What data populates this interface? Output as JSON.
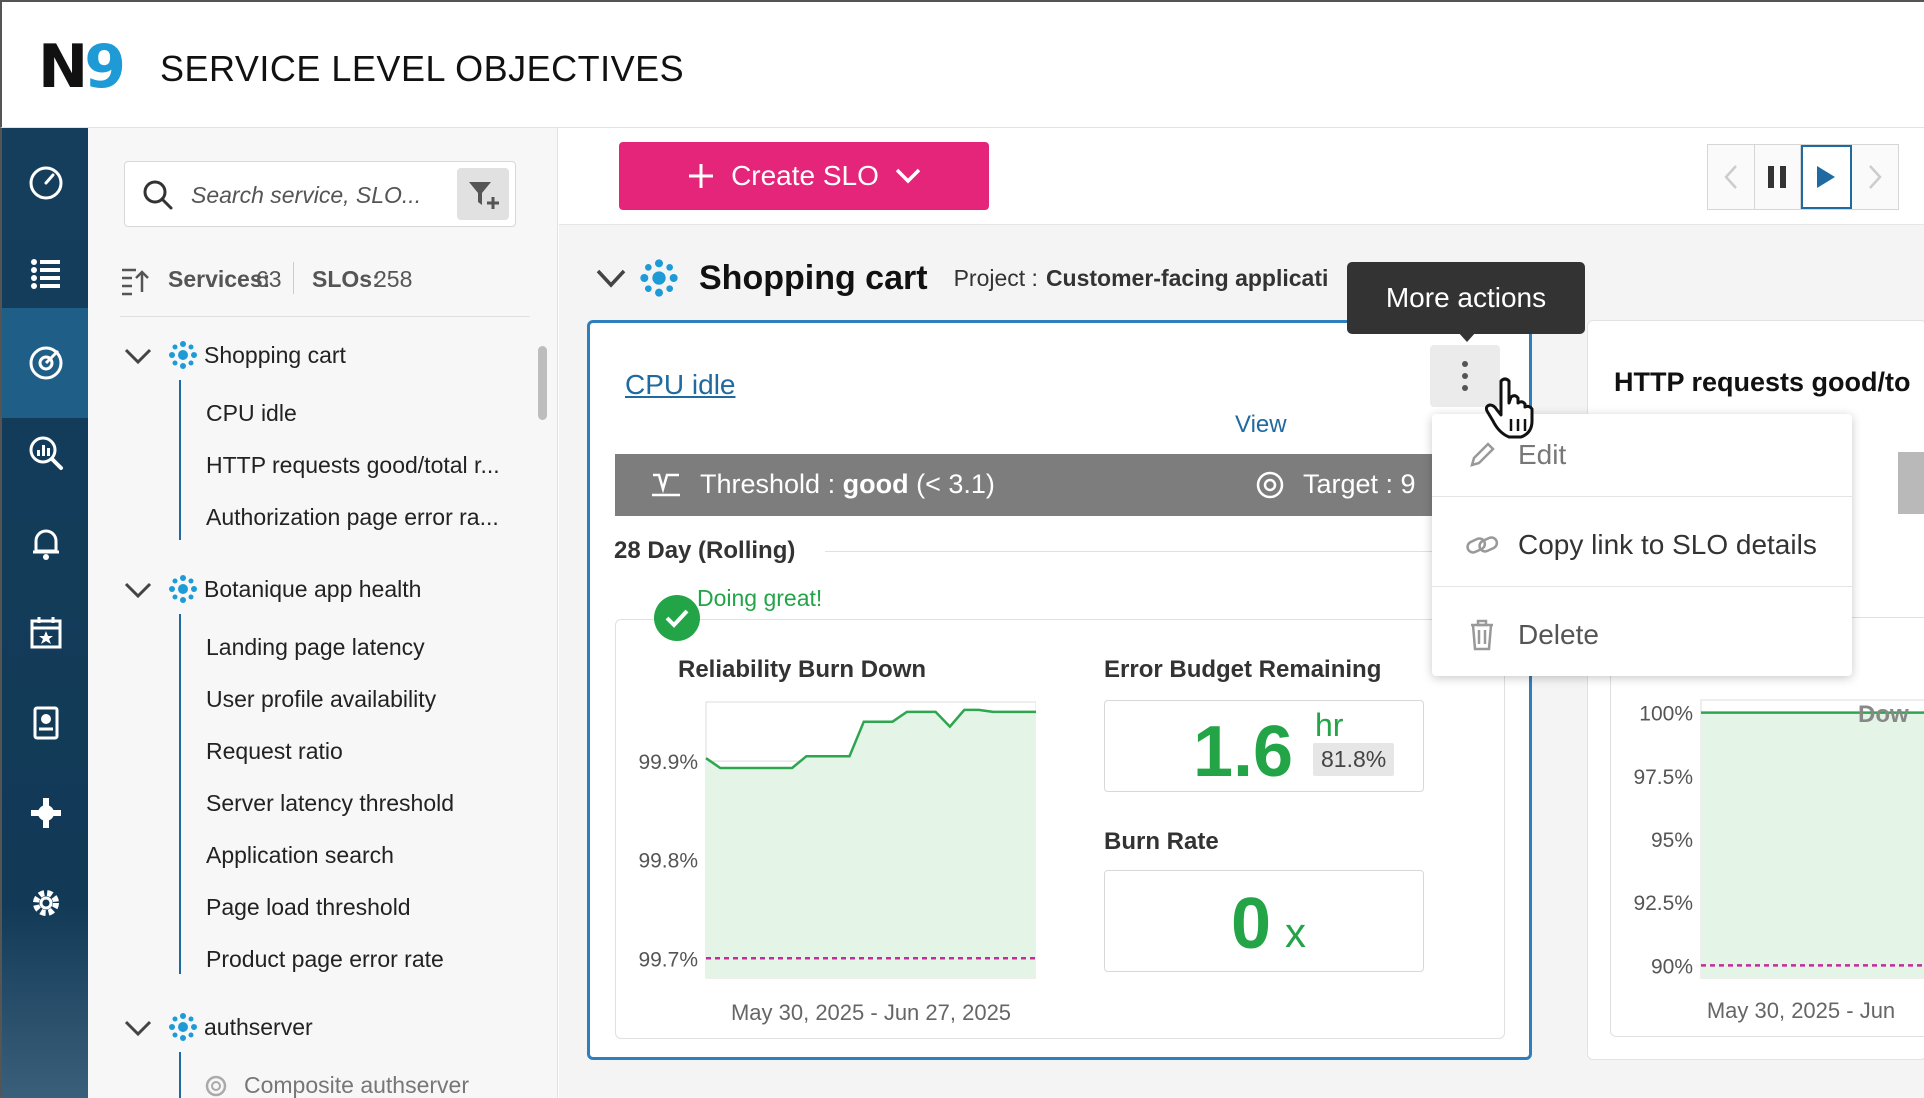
{
  "header": {
    "logo_n": "N",
    "logo_nine": "9",
    "title": "SERVICE LEVEL OBJECTIVES"
  },
  "sidebar": {
    "search_placeholder": "Search service, SLO...",
    "services_label": "Services:",
    "services_count": "63",
    "slos_label": "SLOs:",
    "slos_count": "258",
    "groups": [
      {
        "name": "Shopping cart",
        "items": [
          "CPU idle",
          "HTTP requests good/total r...",
          "Authorization page error ra..."
        ]
      },
      {
        "name": "Botanique app health",
        "items": [
          "Landing page latency",
          "User profile availability",
          "Request ratio",
          "Server latency threshold",
          "Application search",
          "Page load threshold",
          "Product page error rate"
        ]
      },
      {
        "name": "authserver",
        "items": [
          "Composite authserver"
        ]
      }
    ]
  },
  "toolbar": {
    "create_label": "Create SLO"
  },
  "service": {
    "name": "Shopping cart",
    "project_label": "Project :",
    "project_name": "Customer-facing applicati"
  },
  "card": {
    "title": "CPU idle",
    "view_link": "View",
    "threshold_label": "Threshold :",
    "threshold_value": "good",
    "threshold_cond": "(< 3.1)",
    "target_label": "Target : 9",
    "period": "28 Day (Rolling)",
    "status": "Doing great!",
    "rbd_title": "Reliability Burn Down",
    "ebr_title": "Error Budget Remaining",
    "ebr_value": "1.6",
    "ebr_unit": "hr",
    "ebr_percent": "81.8%",
    "br_title": "Burn Rate",
    "br_value": "0",
    "br_unit": "x"
  },
  "chart_data": [
    {
      "type": "area",
      "title": "Reliability Burn Down",
      "y_ticks": [
        "99.9%",
        "99.8%",
        "99.7%"
      ],
      "ylim": [
        99.68,
        99.96
      ],
      "x_range_label": "May 30, 2025 - Jun 27, 2025",
      "series": [
        {
          "values": [
            99.903,
            99.893,
            99.893,
            99.893,
            99.893,
            99.893,
            99.893,
            99.905,
            99.905,
            99.905,
            99.905,
            99.94,
            99.94,
            99.94,
            99.95,
            99.95,
            99.95,
            99.935,
            99.952,
            99.952,
            99.95,
            99.95,
            99.95,
            99.95
          ]
        }
      ],
      "target_line": 99.7
    },
    {
      "type": "area",
      "title": "Dow",
      "y_ticks": [
        "100%",
        "97.5%",
        "95%",
        "92.5%",
        "90%"
      ],
      "ylim": [
        89.5,
        100.5
      ],
      "x_range_label": "May 30, 2025 - Jun",
      "series": [
        {
          "values": [
            100,
            100,
            100,
            100
          ]
        }
      ],
      "target_line": 90
    }
  ],
  "card2": {
    "title": "HTTP requests good/to",
    "fragment": "Dow"
  },
  "tooltip": "More actions",
  "menu": {
    "edit": "Edit",
    "copy_link": "Copy link to SLO details",
    "delete": "Delete"
  }
}
